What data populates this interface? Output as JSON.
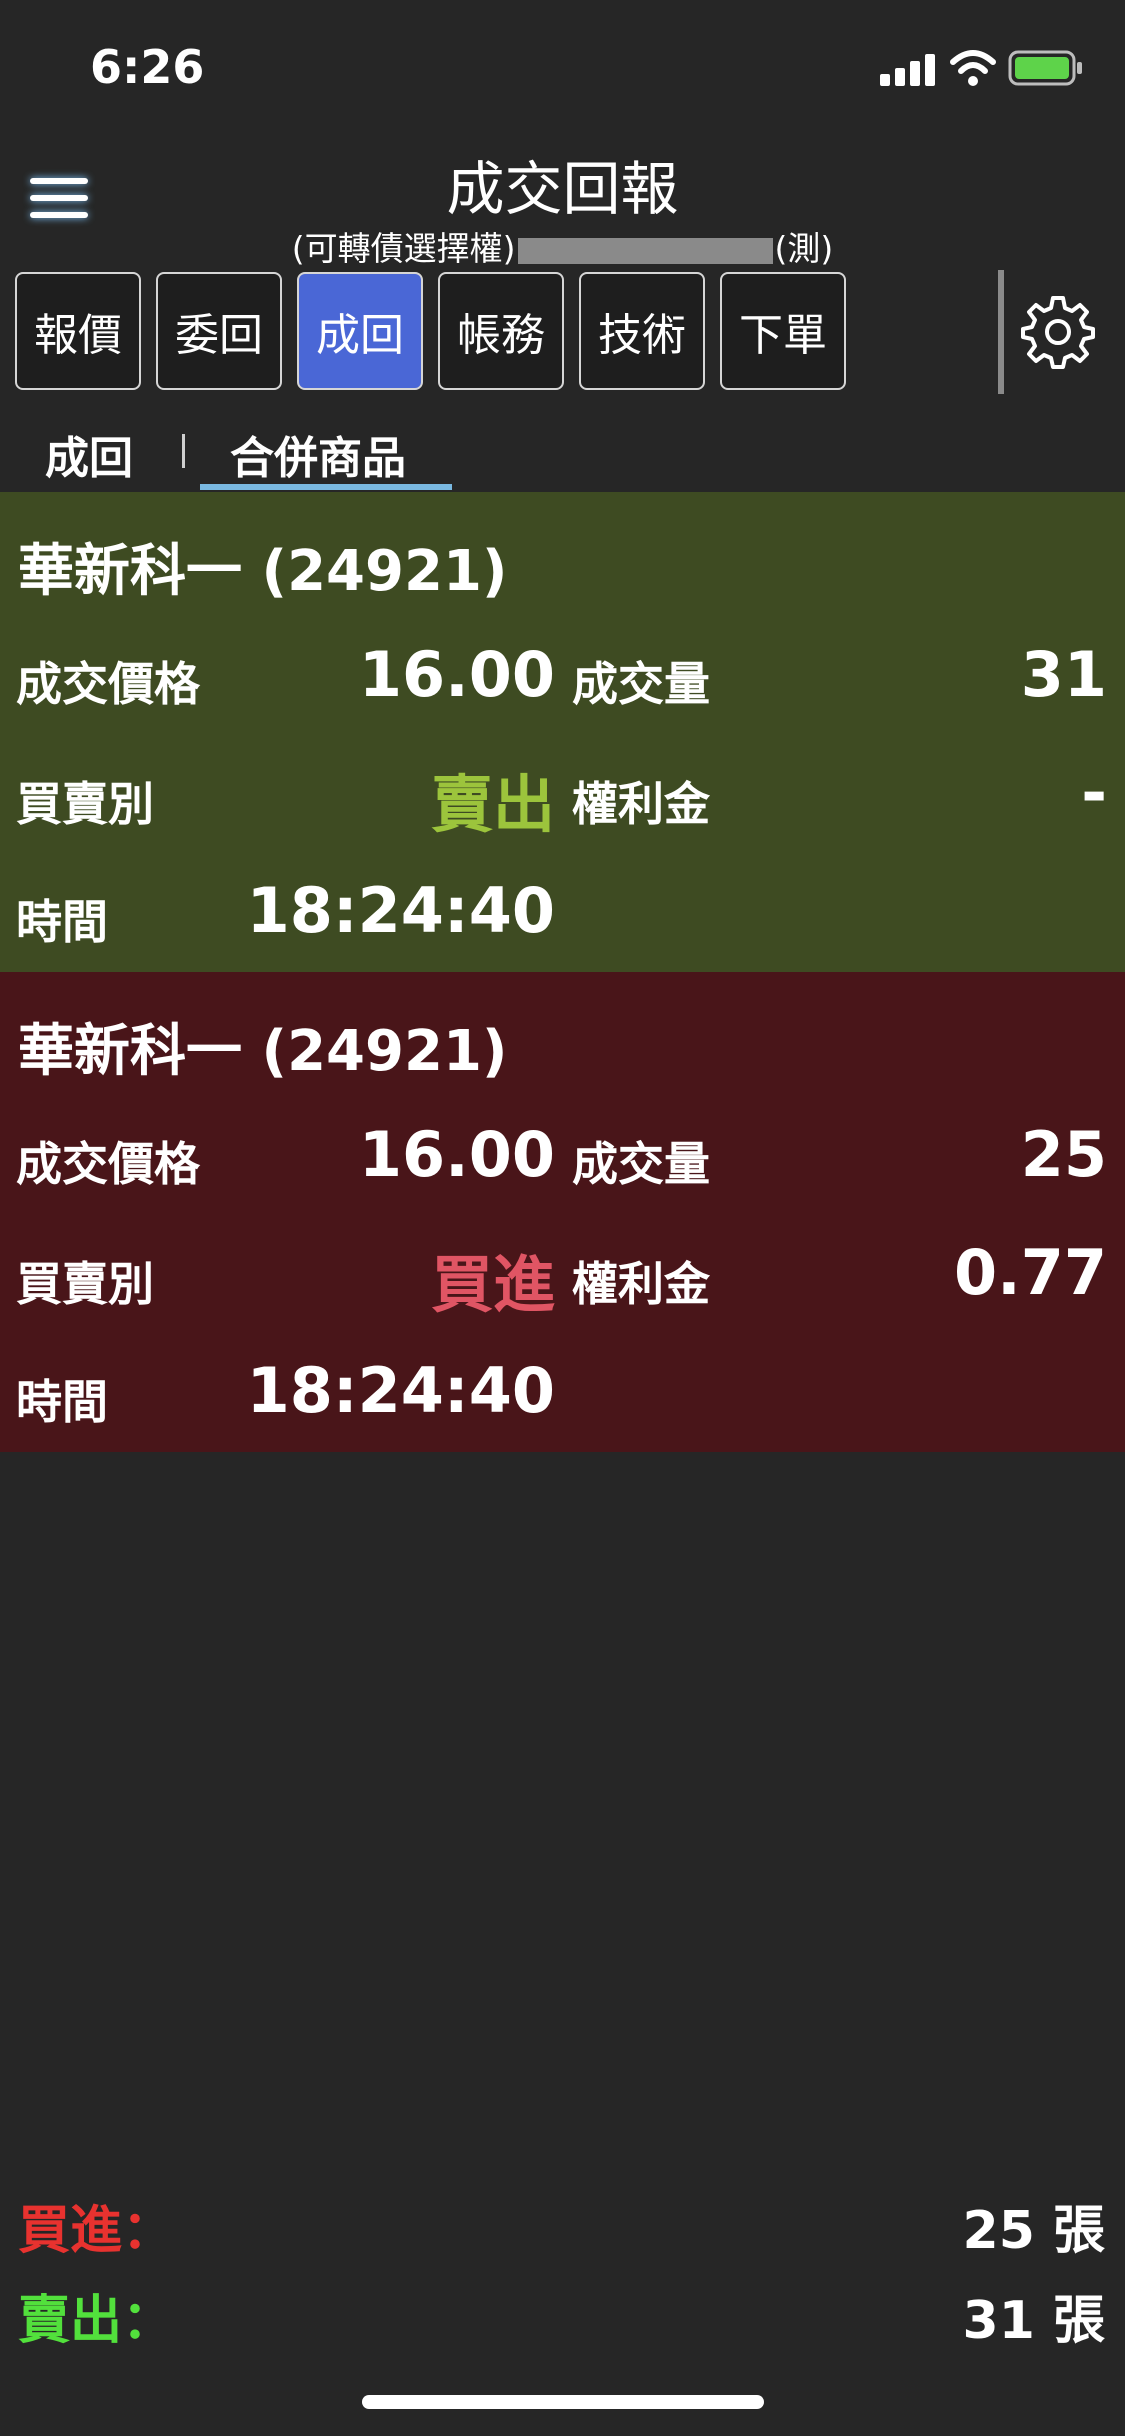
{
  "status_bar": {
    "time": "6:26"
  },
  "header": {
    "title": "成交回報",
    "subtitle_prefix": "(可轉債選擇權)",
    "subtitle_suffix": "(測)"
  },
  "toolbar": {
    "tabs": [
      {
        "label": "報價"
      },
      {
        "label": "委回"
      },
      {
        "label": "成回"
      },
      {
        "label": "帳務"
      },
      {
        "label": "技術"
      },
      {
        "label": "下單"
      }
    ],
    "active_tab": "成回"
  },
  "subtabs": {
    "items": [
      {
        "label": "成回"
      },
      {
        "label": "合併商品"
      }
    ],
    "active": "合併商品"
  },
  "labels": {
    "price": "成交價格",
    "volume": "成交量",
    "side": "買賣別",
    "premium": "權利金",
    "time": "時間"
  },
  "trades": [
    {
      "name": "華新科一 (24921)",
      "price": "16.00",
      "volume": "31",
      "side": "賣出",
      "premium": "-",
      "time": "18:24:40"
    },
    {
      "name": "華新科一 (24921)",
      "price": "16.00",
      "volume": "25",
      "side": "買進",
      "premium": "0.77",
      "time": "18:24:40"
    }
  ],
  "summary": {
    "buy_label": "買進：",
    "buy_value": "25 張",
    "sell_label": "賣出：",
    "sell_value": "31 張"
  },
  "colors": {
    "sell_card_bg": "#3e4b22",
    "buy_card_bg": "#491519",
    "active_tab": "#4a67d6",
    "sell_text": "#9cc43c",
    "buy_text": "#e05564"
  }
}
